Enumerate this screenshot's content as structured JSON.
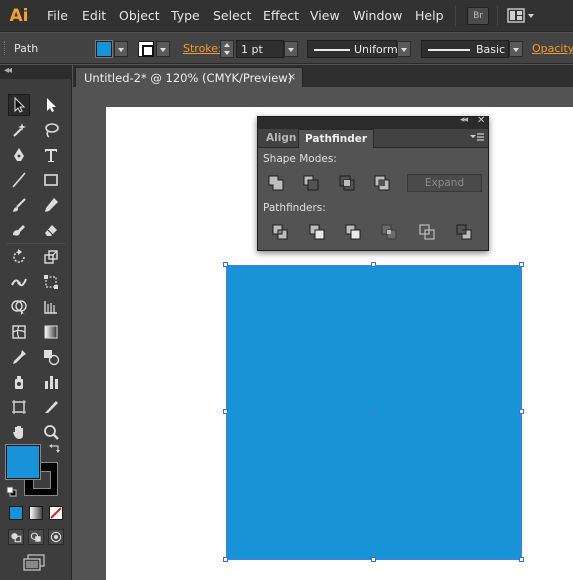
{
  "app": {
    "logo_text": "Ai",
    "logo_color": "#f7a230"
  },
  "menubar": {
    "items": [
      "File",
      "Edit",
      "Object",
      "Type",
      "Select",
      "Effect",
      "View",
      "Window",
      "Help"
    ],
    "bridge_label": "Br"
  },
  "control_bar": {
    "selection_label": "Path",
    "fill_color": "#1893d8",
    "stroke_label": "Stroke:",
    "stroke_weight": "1 pt",
    "variable_width_profile": "Uniform",
    "brush_definition": "Basic",
    "opacity_label": "Opacity:",
    "accent_color": "#f29a31"
  },
  "tools_panel": {
    "collapse_glyph": "◂◂",
    "tools": [
      "selection-tool",
      "direct-selection-tool",
      "magic-wand-tool",
      "lasso-tool",
      "pen-tool",
      "type-tool",
      "line-segment-tool",
      "rectangle-tool",
      "paintbrush-tool",
      "pencil-tool",
      "blob-brush-tool",
      "eraser-tool",
      "rotate-tool",
      "scale-tool",
      "width-tool",
      "free-transform-tool",
      "shape-builder-tool",
      "perspective-grid-tool",
      "mesh-tool",
      "gradient-tool",
      "eyedropper-tool",
      "blend-tool",
      "symbol-sprayer-tool",
      "column-graph-tool",
      "artboard-tool",
      "slice-tool",
      "hand-tool",
      "zoom-tool"
    ],
    "fill_color": "#1893d8",
    "stroke_color": "#000000"
  },
  "document": {
    "tab_title": "Untitled-2* @ 120% (CMYK/Preview)",
    "close_glyph": "×"
  },
  "pathfinder_panel": {
    "collapse_glyph": "◂◂",
    "close_glyph": "✕",
    "tabs": [
      "Align",
      "Pathfinder"
    ],
    "active_tab": "Pathfinder",
    "shape_modes_label": "Shape Modes:",
    "shape_modes": [
      "unite-icon",
      "minus-front-icon",
      "intersect-icon",
      "exclude-icon"
    ],
    "expand_label": "Expand",
    "pathfinders_label": "Pathfinders:",
    "pathfinders": [
      "divide-icon",
      "trim-icon",
      "merge-icon",
      "crop-icon",
      "outline-icon",
      "minus-back-icon"
    ]
  },
  "canvas": {
    "artboard_color": "#ffffff",
    "selected_shape_fill": "#1893d8",
    "selection_color": "#4a7be0"
  }
}
